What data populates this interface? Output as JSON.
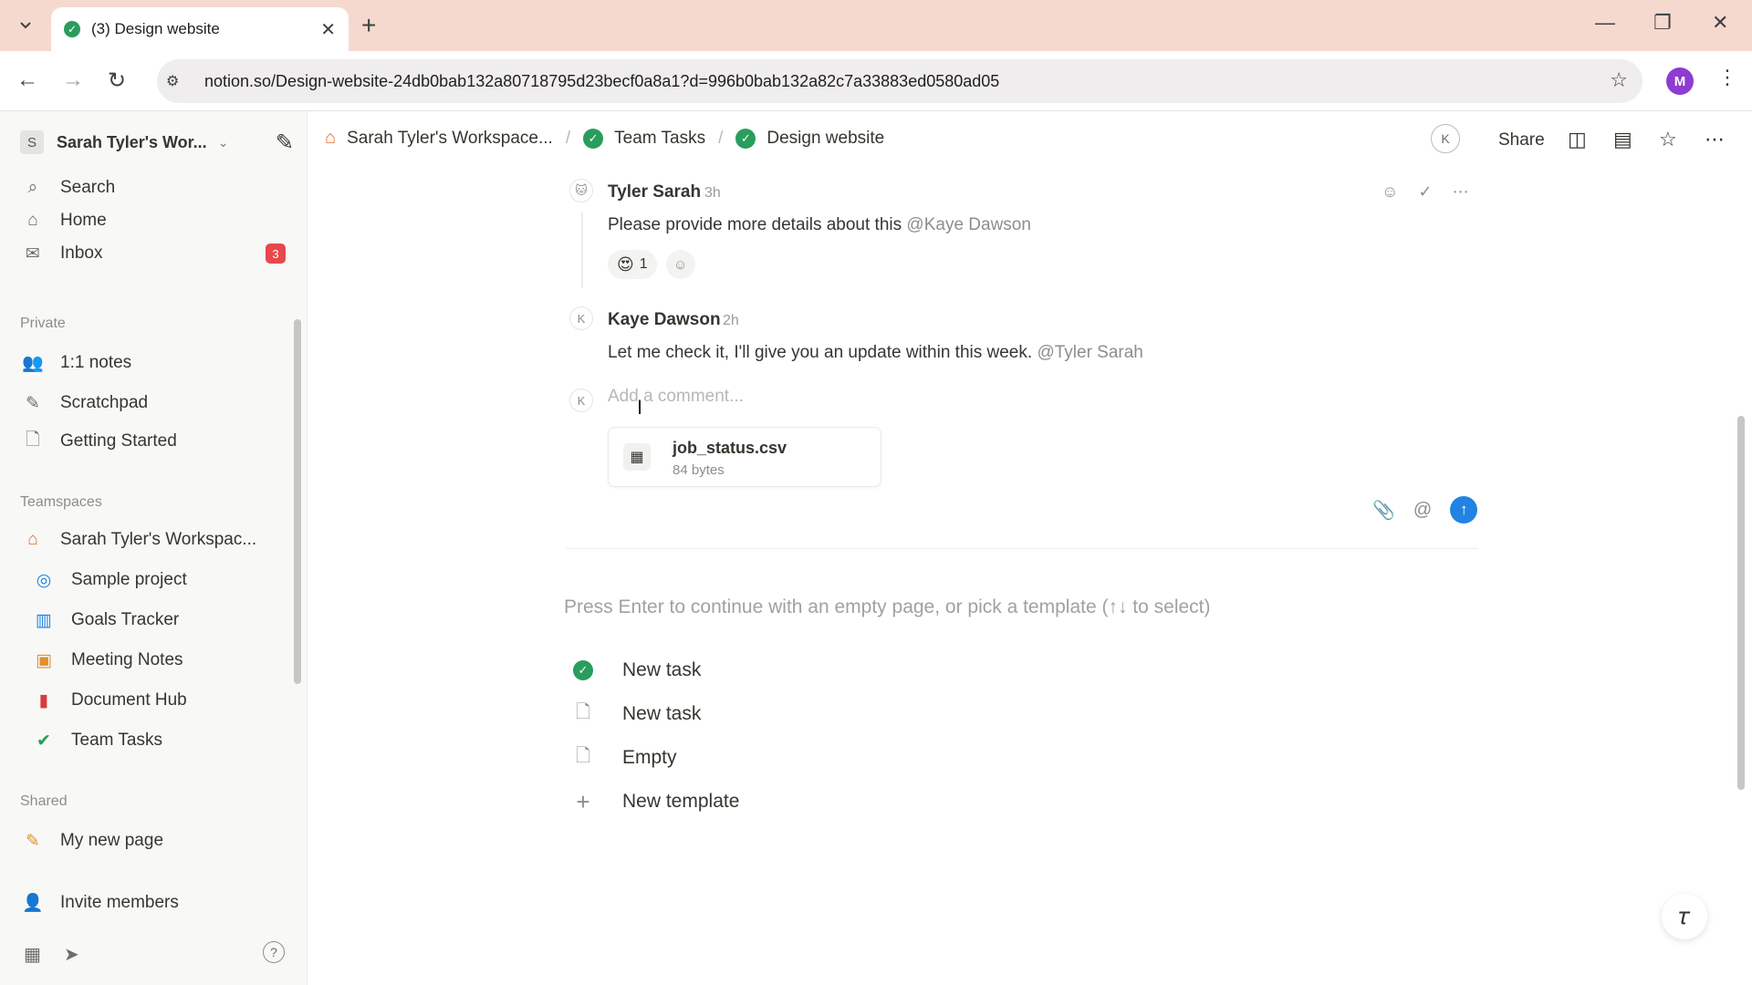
{
  "browser": {
    "tab_title": "(3) Design website",
    "url": "notion.so/Design-website-24db0bab132a80718795d23becf0a8a1?d=996b0bab132a82c7a33883ed0580ad05",
    "profile_initial": "M"
  },
  "sidebar": {
    "workspace_initial": "S",
    "workspace_name": "Sarah Tyler's Wor...",
    "top_items": [
      {
        "label": "Search",
        "icon": "search-icon"
      },
      {
        "label": "Home",
        "icon": "home-icon"
      },
      {
        "label": "Inbox",
        "icon": "inbox-icon",
        "badge": "3"
      }
    ],
    "private_heading": "Private",
    "private_items": [
      {
        "label": "1:1 notes",
        "icon": "people-icon"
      },
      {
        "label": "Scratchpad",
        "icon": "pencil-icon"
      },
      {
        "label": "Getting Started",
        "icon": "page-icon"
      }
    ],
    "teamspaces_heading": "Teamspaces",
    "teamspace_name": "Sarah Tyler's Workspac...",
    "teamspace_items": [
      {
        "label": "Sample project",
        "icon": "project-icon"
      },
      {
        "label": "Goals Tracker",
        "icon": "chart-icon"
      },
      {
        "label": "Meeting Notes",
        "icon": "calendar-icon"
      },
      {
        "label": "Document Hub",
        "icon": "document-icon"
      },
      {
        "label": "Team Tasks",
        "icon": "check-circle-icon"
      }
    ],
    "shared_heading": "Shared",
    "shared_items": [
      {
        "label": "My new page",
        "icon": "pencil-icon"
      }
    ],
    "invite_label": "Invite members"
  },
  "topbar": {
    "breadcrumbs": [
      "Sarah Tyler's Workspace...",
      "Team Tasks",
      "Design website"
    ],
    "avatar_initial": "K",
    "share_label": "Share"
  },
  "comments": [
    {
      "author": "Tyler Sarah",
      "time": "3h",
      "text": "Please provide more details about this",
      "mention": "@Kaye Dawson",
      "reaction_count": "1"
    },
    {
      "author": "Kaye Dawson",
      "avatar": "K",
      "time": "2h",
      "text": "Let me check it, I'll give you an update within this week.",
      "mention": "@Tyler Sarah"
    }
  ],
  "comment_input": {
    "avatar": "K",
    "placeholder": "Add a comment...",
    "attachment": {
      "name": "job_status.csv",
      "size": "84 bytes"
    }
  },
  "templates": {
    "hint": "Press Enter to continue with an empty page, or pick a template (↑↓ to select)",
    "items": [
      {
        "label": "New task",
        "icon": "check-circle-icon"
      },
      {
        "label": "New task",
        "icon": "page-icon"
      },
      {
        "label": "Empty",
        "icon": "page-icon"
      },
      {
        "label": "New template",
        "icon": "plus-icon"
      }
    ]
  },
  "colors": {
    "accent_blue": "#2383e2",
    "success_green": "#2a9d5c",
    "badge_red": "#e8474b",
    "tabbar_bg": "#f6d9ce"
  }
}
